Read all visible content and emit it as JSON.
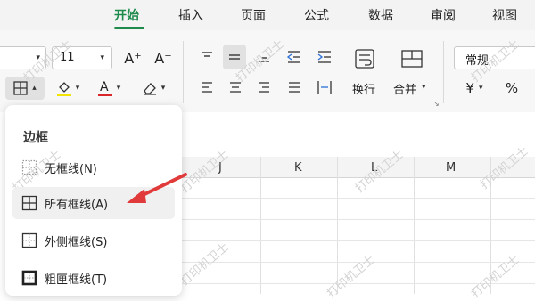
{
  "tabs": [
    "开始",
    "插入",
    "页面",
    "公式",
    "数据",
    "审阅",
    "视图"
  ],
  "active_tab": "开始",
  "ribbon": {
    "font_size": "11",
    "increase_font": "A⁺",
    "decrease_font": "A⁻",
    "wrap_label": "换行",
    "merge_label": "合并",
    "number_format": "常规",
    "currency": "¥",
    "percent": "%"
  },
  "columns": [
    "J",
    "K",
    "L",
    "M"
  ],
  "border_menu": {
    "title": "边框",
    "items": [
      {
        "label": "无框线(N)",
        "icon": "no-border-icon"
      },
      {
        "label": "所有框线(A)",
        "icon": "all-borders-icon"
      },
      {
        "label": "外侧框线(S)",
        "icon": "outside-borders-icon"
      },
      {
        "label": "粗匣框线(T)",
        "icon": "thick-box-border-icon"
      }
    ]
  },
  "watermark": "打印机卫士",
  "colors": {
    "accent": "#1e8a4c",
    "font_color": "#d9262b",
    "fill_color": "#f2e300",
    "arrow": "#e03a3a"
  }
}
